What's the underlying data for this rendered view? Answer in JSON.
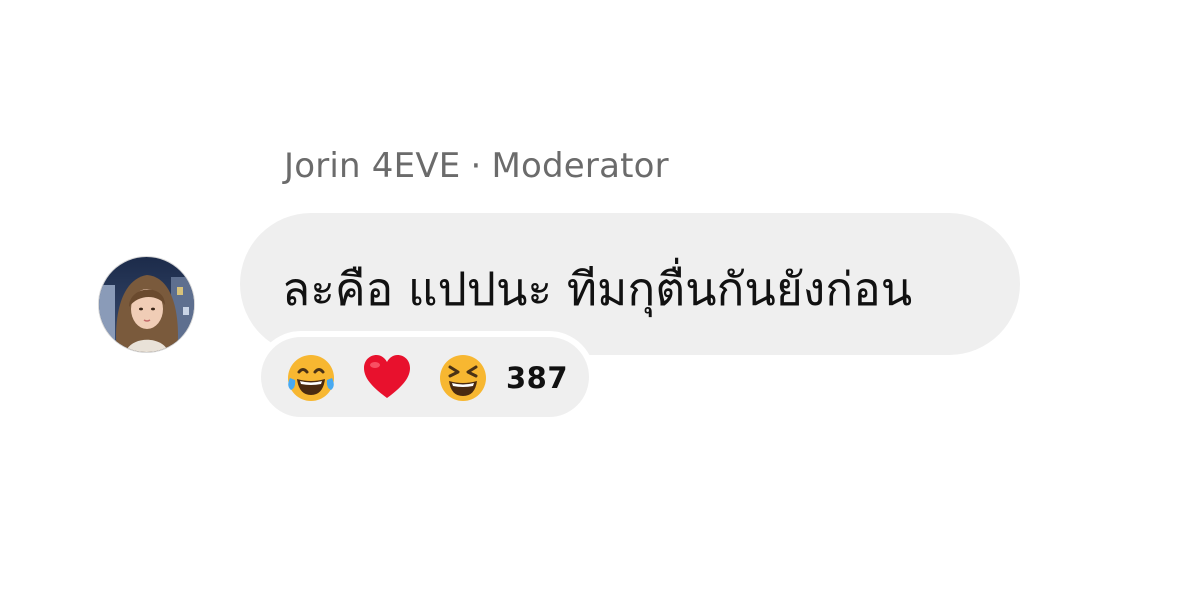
{
  "comment": {
    "author": "Jorin 4EVE",
    "separator": "·",
    "role": "Moderator",
    "text": "ละคือ แปปนะ ทีมกุตื่นกันยังก่อน",
    "avatar_icon": "profile-photo",
    "reactions": {
      "icons": [
        "laughing-tears-emoji",
        "red-heart-emoji",
        "grinning-squinting-emoji"
      ],
      "count": "387"
    }
  },
  "colors": {
    "bubble": "#efefef",
    "author": "#6b6b6b",
    "text": "#111111",
    "heart": "#e8112d",
    "emoji_face": "#f7b731"
  }
}
